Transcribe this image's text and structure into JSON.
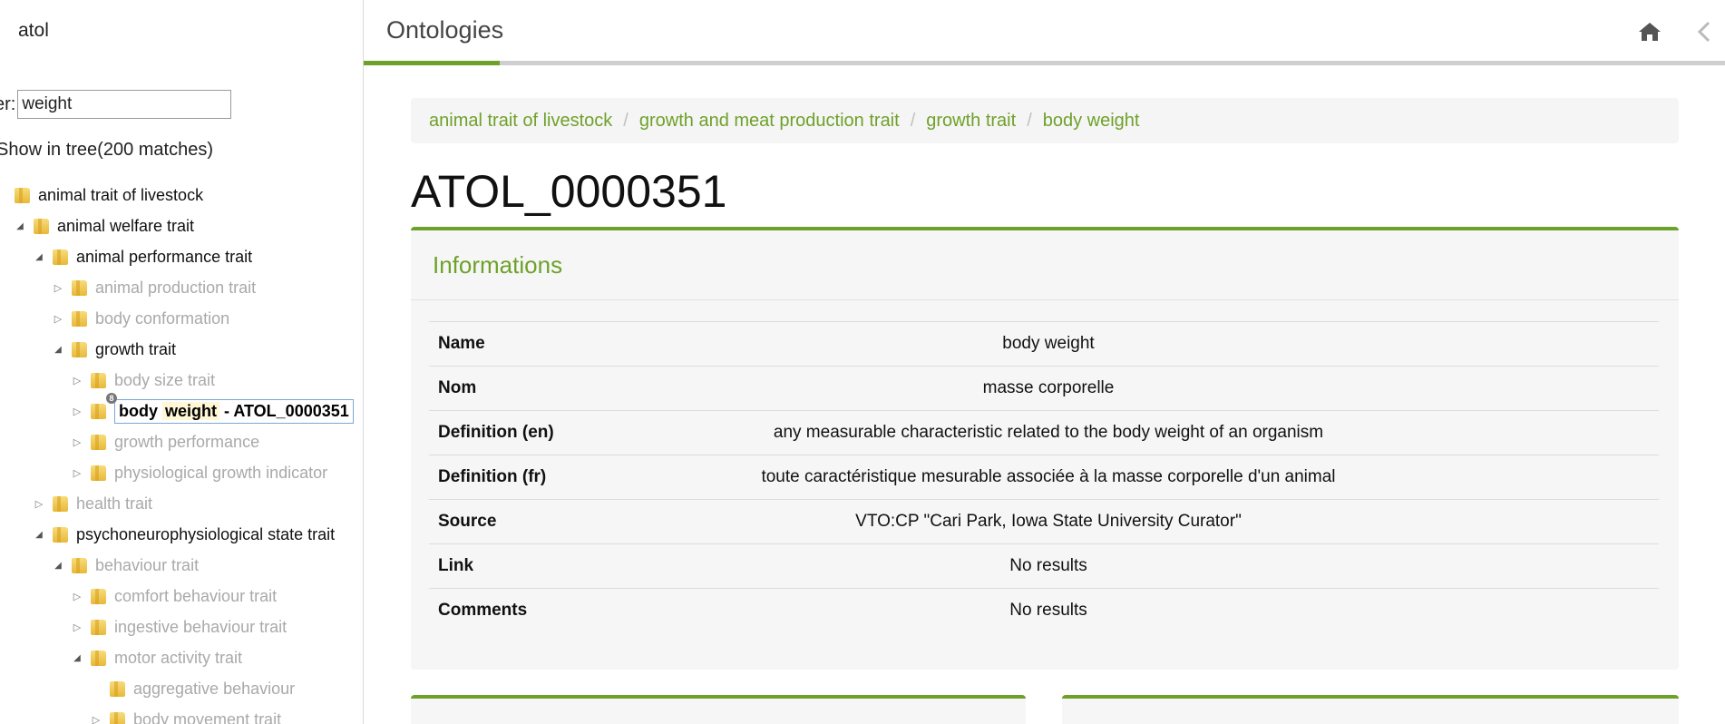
{
  "sidebar": {
    "ontology_name": "atol",
    "filter_label": "er:",
    "filter_value": "weight",
    "show_in_tree": "Show in tree(200 matches)",
    "tree": [
      {
        "label": "animal trait of livestock",
        "level": 0,
        "toggle": "none",
        "style": "black"
      },
      {
        "label": "animal welfare trait",
        "level": 1,
        "toggle": "open",
        "style": "black"
      },
      {
        "label": "animal performance trait",
        "level": 2,
        "toggle": "open",
        "style": "black"
      },
      {
        "label": "animal production trait",
        "level": 3,
        "toggle": "closed",
        "style": "gray"
      },
      {
        "label": "body conformation",
        "level": 3,
        "toggle": "closed",
        "style": "gray"
      },
      {
        "label": "growth trait",
        "level": 3,
        "toggle": "open",
        "style": "black"
      },
      {
        "label": "body size trait",
        "level": 4,
        "toggle": "closed",
        "style": "gray"
      },
      {
        "label": "body weight - ATOL_0000351",
        "level": 4,
        "toggle": "closed",
        "style": "selected"
      },
      {
        "label": "growth performance",
        "level": 4,
        "toggle": "closed",
        "style": "gray"
      },
      {
        "label": "physiological growth indicator",
        "level": 4,
        "toggle": "closed",
        "style": "gray"
      },
      {
        "label": "health trait",
        "level": 2,
        "toggle": "closed",
        "style": "gray"
      },
      {
        "label": "psychoneurophysiological state trait",
        "level": 2,
        "toggle": "open",
        "style": "black"
      },
      {
        "label": "behaviour trait",
        "level": 3,
        "toggle": "open",
        "style": "gray"
      },
      {
        "label": "comfort behaviour trait",
        "level": 4,
        "toggle": "closed",
        "style": "gray"
      },
      {
        "label": "ingestive behaviour trait",
        "level": 4,
        "toggle": "closed",
        "style": "gray"
      },
      {
        "label": "motor activity trait",
        "level": 4,
        "toggle": "open",
        "style": "gray"
      },
      {
        "label": "aggregative behaviour",
        "level": 5,
        "toggle": "none",
        "style": "gray"
      },
      {
        "label": "body movement trait",
        "level": 5,
        "toggle": "closed",
        "style": "gray"
      }
    ],
    "selected": {
      "word1": "body",
      "word2": "weight",
      "suffix": "- ATOL_0000351",
      "badge": "8"
    }
  },
  "topbar": {
    "title": "Ontologies",
    "progress": 0.1,
    "home_icon": "home-icon",
    "back_icon": "chevron-left-icon"
  },
  "breadcrumb": [
    "animal trait of livestock",
    "growth and meat production trait",
    "growth trait",
    "body weight"
  ],
  "entity_id": "ATOL_0000351",
  "informations": {
    "heading": "Informations",
    "rows": [
      {
        "key": "Name",
        "value": "body weight"
      },
      {
        "key": "Nom",
        "value": "masse corporelle"
      },
      {
        "key": "Definition (en)",
        "value": "any measurable characteristic related to the body weight of an organism"
      },
      {
        "key": "Definition (fr)",
        "value": "toute caractéristique mesurable associée à la masse corporelle d'un animal"
      },
      {
        "key": "Source",
        "value": "VTO:CP \"Cari Park, Iowa State University Curator\""
      },
      {
        "key": "Link",
        "value": "No results"
      },
      {
        "key": "Comments",
        "value": "No results"
      }
    ]
  },
  "colors": {
    "accent": "#6ea12a",
    "muted_text": "#a9a9a9"
  }
}
